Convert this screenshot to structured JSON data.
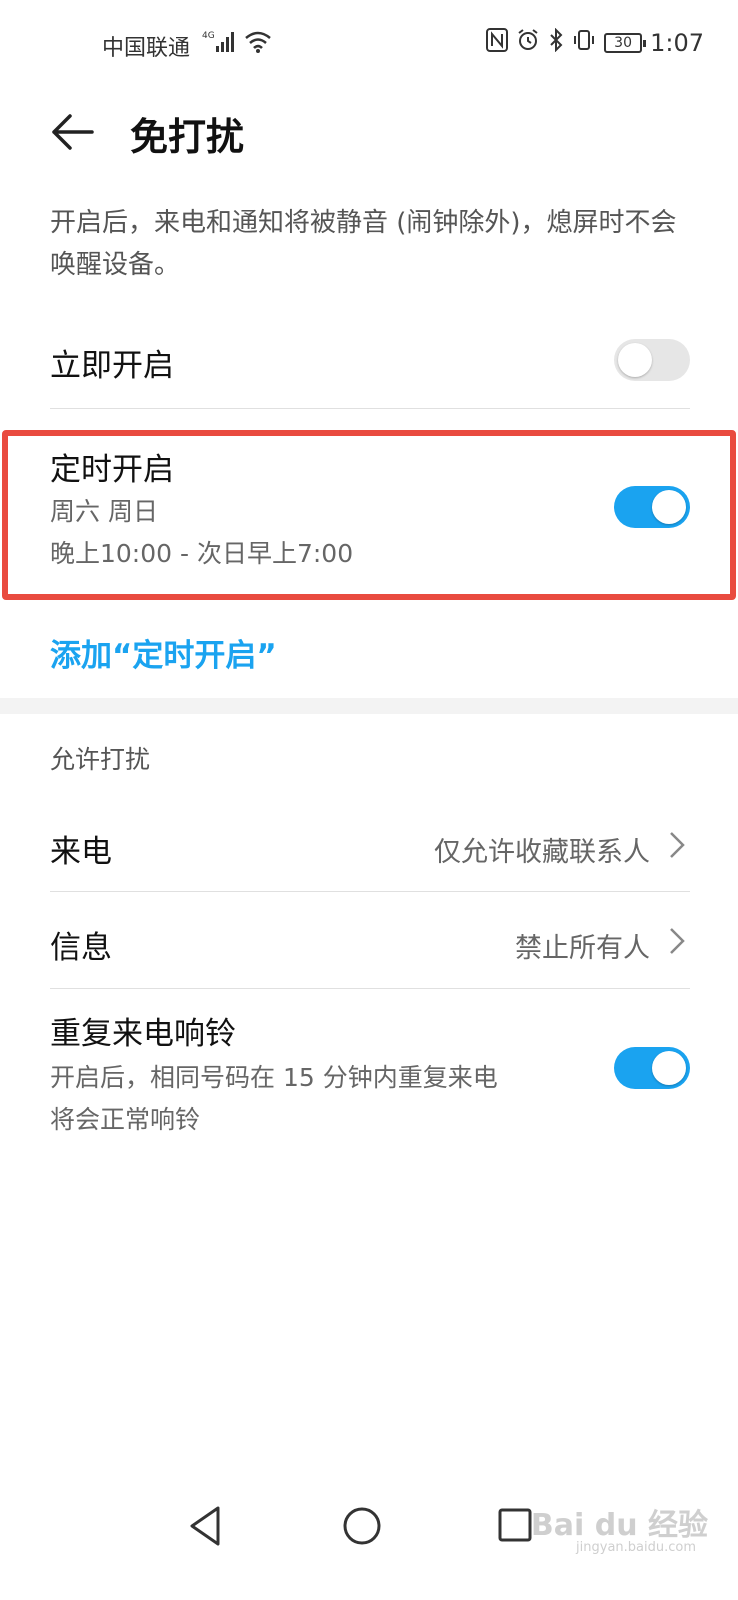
{
  "status_bar": {
    "carrier": "中国联通",
    "network": "4G",
    "battery": "30",
    "time": "1:07"
  },
  "header": {
    "title": "免打扰",
    "back_icon": "arrow-left-icon"
  },
  "description": "开启后，来电和通知将被静音 (闹钟除外)，熄屏时不会唤醒设备。",
  "immediate": {
    "label": "立即开启",
    "enabled": false
  },
  "scheduled": {
    "label": "定时开启",
    "days": "周六 周日",
    "time_range": "晚上10:00 - 次日早上7:00",
    "enabled": true
  },
  "add_schedule_label": "添加“定时开启”",
  "allow_section": {
    "title": "允许打扰",
    "calls_label": "来电",
    "calls_value": "仅允许收藏联系人",
    "messages_label": "信息",
    "messages_value": "禁止所有人",
    "repeat_label": "重复来电响铃",
    "repeat_desc_line1": "开启后，相同号码在 15 分钟内重复来电",
    "repeat_desc_line2": "将会正常响铃",
    "repeat_enabled": true
  },
  "watermark": {
    "text": "Bai du 经验",
    "sub": "jingyan.baidu.com"
  },
  "colors": {
    "accent": "#1aa3f0",
    "highlight_border": "#e94b3f"
  }
}
